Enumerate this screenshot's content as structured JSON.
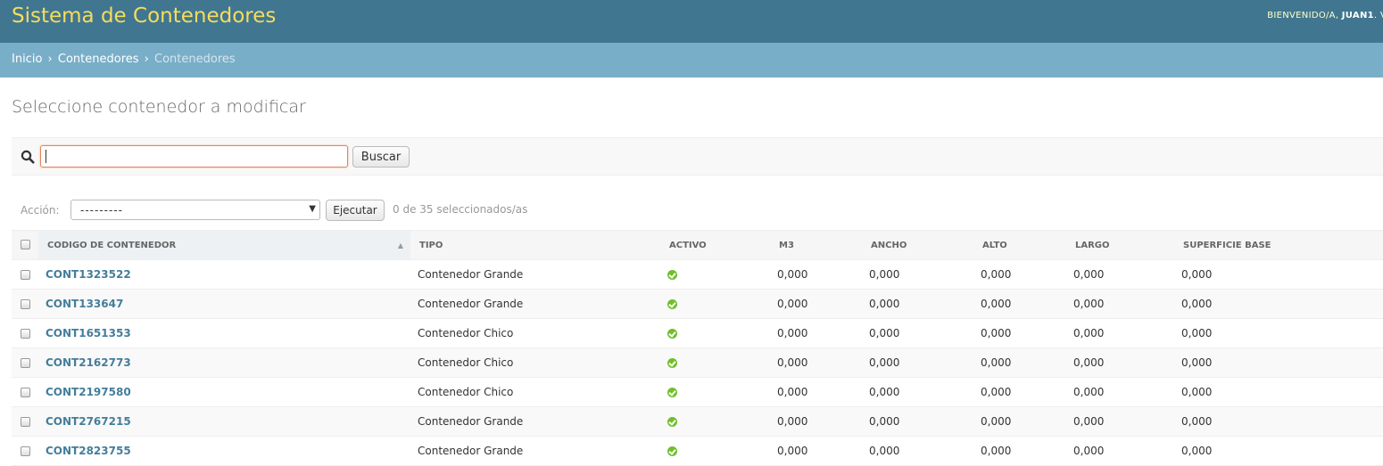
{
  "header": {
    "title": "Sistema de Contenedores",
    "welcome": "BIENVENIDO/A,",
    "username": "JUAN1",
    "trailing": ". V"
  },
  "breadcrumbs": {
    "home": "Inicio",
    "section": "Contenedores",
    "current": "Contenedores"
  },
  "page_title": "Seleccione contenedor a modificar",
  "search": {
    "value": "",
    "button_label": "Buscar"
  },
  "actions": {
    "label": "Acción:",
    "selected": "---------",
    "execute_label": "Ejecutar",
    "counter": "0 de 35 seleccionados/as"
  },
  "table": {
    "columns": [
      "Codigo de contenedor",
      "Tipo",
      "Activo",
      "M3",
      "Ancho",
      "Alto",
      "Largo",
      "Superficie base"
    ],
    "rows": [
      {
        "code": "CONT1323522",
        "tipo": "Contenedor Grande",
        "m3": "0,000",
        "ancho": "0,000",
        "alto": "0,000",
        "largo": "0,000",
        "superficie": "0,000"
      },
      {
        "code": "CONT133647",
        "tipo": "Contenedor Grande",
        "m3": "0,000",
        "ancho": "0,000",
        "alto": "0,000",
        "largo": "0,000",
        "superficie": "0,000"
      },
      {
        "code": "CONT1651353",
        "tipo": "Contenedor Chico",
        "m3": "0,000",
        "ancho": "0,000",
        "alto": "0,000",
        "largo": "0,000",
        "superficie": "0,000"
      },
      {
        "code": "CONT2162773",
        "tipo": "Contenedor Chico",
        "m3": "0,000",
        "ancho": "0,000",
        "alto": "0,000",
        "largo": "0,000",
        "superficie": "0,000"
      },
      {
        "code": "CONT2197580",
        "tipo": "Contenedor Chico",
        "m3": "0,000",
        "ancho": "0,000",
        "alto": "0,000",
        "largo": "0,000",
        "superficie": "0,000"
      },
      {
        "code": "CONT2767215",
        "tipo": "Contenedor Grande",
        "m3": "0,000",
        "ancho": "0,000",
        "alto": "0,000",
        "largo": "0,000",
        "superficie": "0,000"
      },
      {
        "code": "CONT2823755",
        "tipo": "Contenedor Grande",
        "m3": "0,000",
        "ancho": "0,000",
        "alto": "0,000",
        "largo": "0,000",
        "superficie": "0,000"
      }
    ]
  },
  "colors": {
    "header_bg": "#417690",
    "title_color": "#f5dd5d",
    "breadcrumb_bg": "#79aec8",
    "link": "#447e9b",
    "active_green": "#70bf2b"
  },
  "icons": {
    "search": "search-icon",
    "active": "check-circle-icon",
    "sort": "sort-asc-icon"
  }
}
